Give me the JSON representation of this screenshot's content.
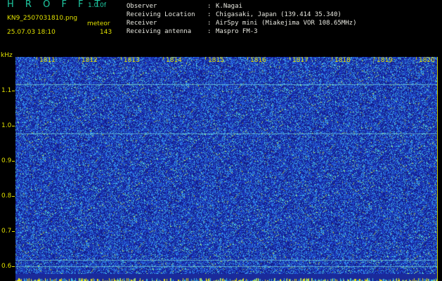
{
  "header": {
    "app_title": "H R O F F T",
    "version": "1.0.0f",
    "filename": "KN9_2507031810.png",
    "mode": "meteor",
    "datetime": "25.07.03 18:10",
    "count": "143"
  },
  "info": [
    {
      "key": "Observer",
      "value": "K.Nagai"
    },
    {
      "key": "Receiving Location",
      "value": "Chigasaki, Japan (139.414 35.340)"
    },
    {
      "key": "Receiver",
      "value": "AirSpy mini (Miakejima VOR 108.65MHz)"
    },
    {
      "key": "Receiving antenna",
      "value": "Maspro FM-3"
    }
  ],
  "axis": {
    "y_unit": "kHz",
    "y_ticks": [
      "1.1",
      "1.0",
      "0.9",
      "0.8",
      "0.7",
      "0.6"
    ],
    "x_ticks": [
      "1811",
      "1812",
      "1813",
      "1814",
      "1815",
      "1816",
      "1817",
      "1818",
      "1819",
      "1820"
    ]
  },
  "colors": {
    "background": "#1a2a9a",
    "text": "#e0e000",
    "title": "#1ec8a0"
  }
}
